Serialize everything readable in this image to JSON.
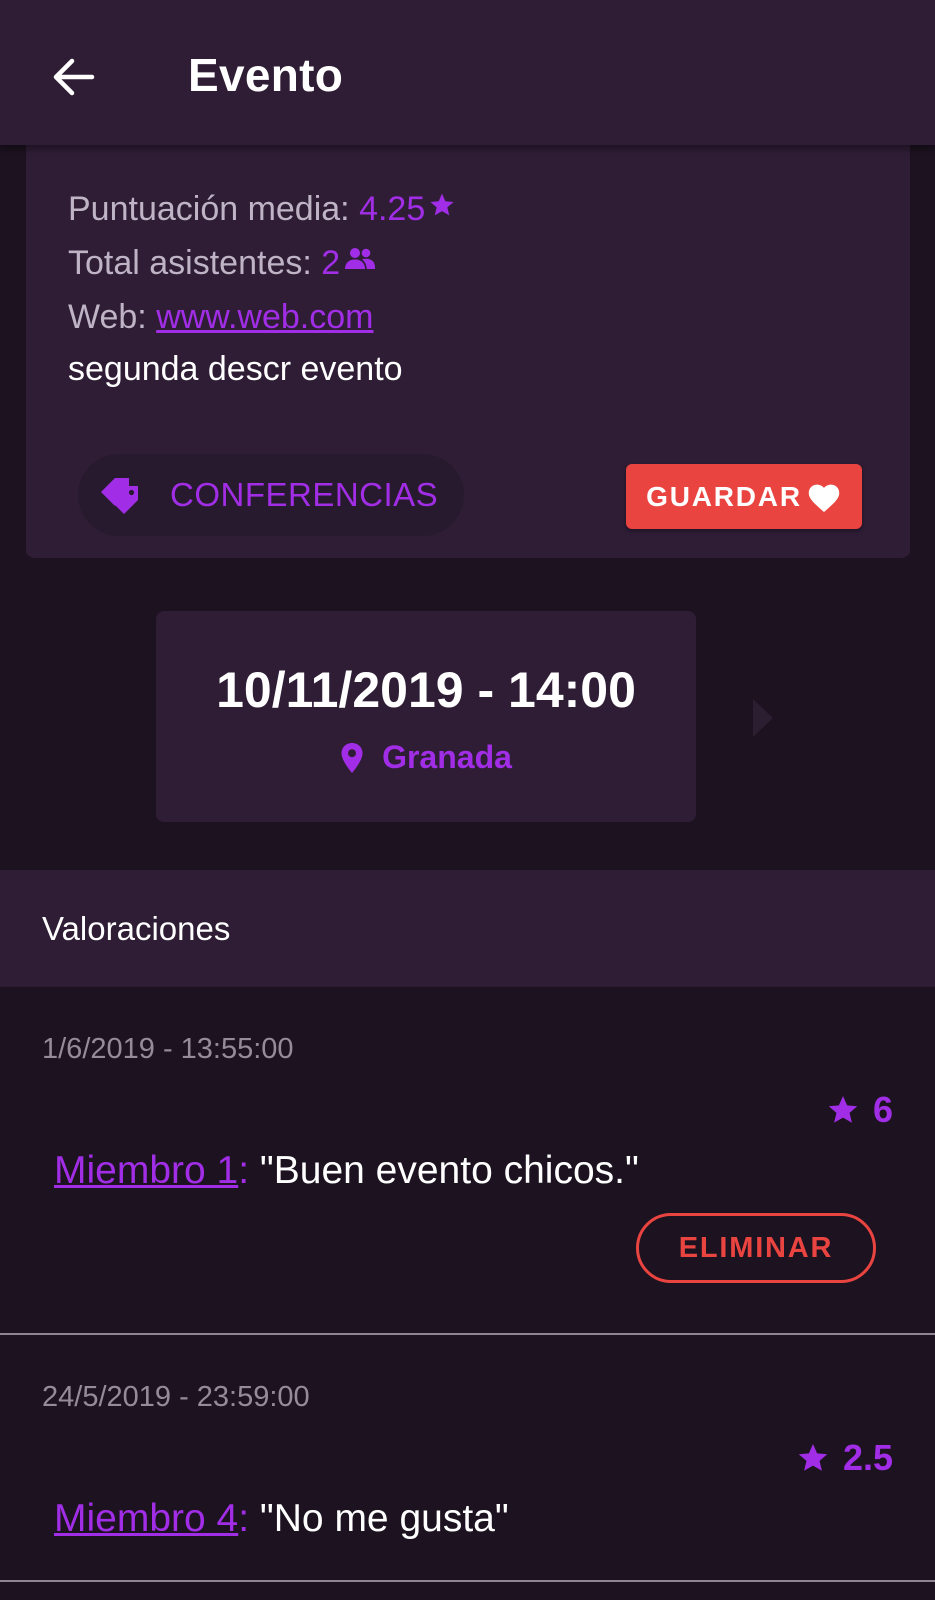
{
  "appbar": {
    "title": "Evento"
  },
  "event": {
    "rating_label": "Puntuación media: ",
    "rating_value": "4.25",
    "attendees_label": "Total asistentes: ",
    "attendees_value": "2",
    "web_label": "Web: ",
    "web_value": "www.web.com",
    "description": "segunda descr evento",
    "category": "CONFERENCIAS",
    "save_label": "GUARDAR"
  },
  "schedule": {
    "datetime": "10/11/2019 - 14:00",
    "location": "Granada"
  },
  "reviews_section": {
    "title": "Valoraciones",
    "items": [
      {
        "date": "1/6/2019 - 13:55:00",
        "rating": "6",
        "member": "Miembro 1",
        "colon": ":",
        "comment": " \"Buen evento chicos.\"",
        "delete_label": "ELIMINAR"
      },
      {
        "date": "24/5/2019 - 23:59:00",
        "rating": "2.5",
        "member": "Miembro 4",
        "colon": ":",
        "comment": " \"No me gusta\""
      }
    ]
  },
  "colors": {
    "accent": "#a12ee6",
    "danger": "#ea4440",
    "surface": "#2f1d36",
    "background": "#1c1220"
  },
  "icons": [
    "arrow-left-icon",
    "star-icon",
    "people-icon",
    "tags-icon",
    "heart-icon",
    "map-pin-icon",
    "chevron-right-icon"
  ]
}
